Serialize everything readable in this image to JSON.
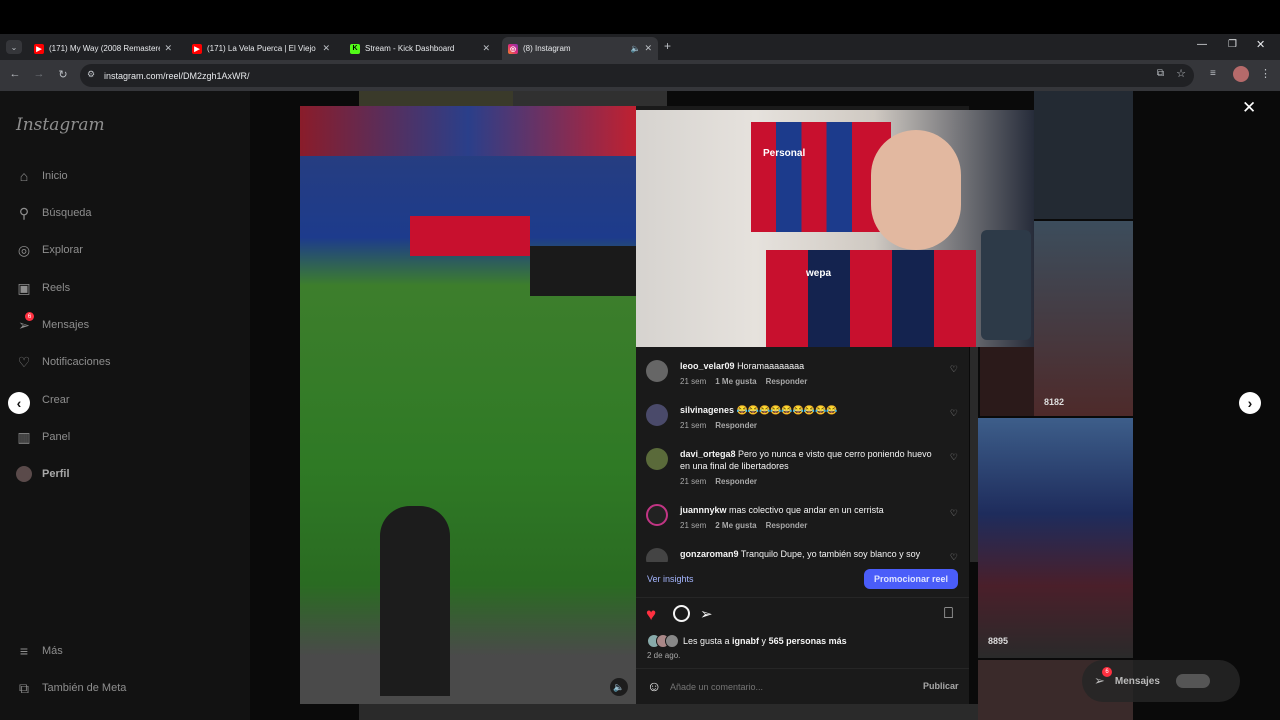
{
  "browser": {
    "tabs": [
      {
        "title": "(171) My Way (2008 Remastered)",
        "favicon": "youtube-icon",
        "active": false
      },
      {
        "title": "(171) La Vela Puerca | El Viejo |",
        "favicon": "youtube-icon",
        "active": false
      },
      {
        "title": "Stream - Kick Dashboard",
        "favicon": "kick-icon",
        "active": false
      },
      {
        "title": "(8) Instagram",
        "favicon": "instagram-icon",
        "active": true
      }
    ],
    "url": "instagram.com/reel/DM2zgh1AxWR/"
  },
  "sidebar": {
    "logo": "Instagram",
    "items": [
      {
        "label": "Inicio",
        "icon": "home-icon"
      },
      {
        "label": "Búsqueda",
        "icon": "search-icon"
      },
      {
        "label": "Explorar",
        "icon": "compass-icon"
      },
      {
        "label": "Reels",
        "icon": "reels-icon"
      },
      {
        "label": "Mensajes",
        "icon": "messages-icon",
        "badge": "6"
      },
      {
        "label": "Notificaciones",
        "icon": "heart-icon"
      },
      {
        "label": "Crear",
        "icon": "plus-icon"
      },
      {
        "label": "Panel",
        "icon": "chart-icon"
      },
      {
        "label": "Perfil",
        "icon": "avatar"
      }
    ],
    "more": "Más",
    "meta": "También de Meta"
  },
  "background": {
    "tile1_caption": "8182",
    "tile2_caption": "8895",
    "messages_label": "Mensajes",
    "messages_badge": "6"
  },
  "camera": {
    "shirt_text": "Personal",
    "jersey_text": "wepa"
  },
  "comments": [
    {
      "user": "leoo_velar09",
      "text": "Horamaaaaaaaa",
      "time": "21 sem",
      "likes": "1 Me gusta",
      "reply": "Responder"
    },
    {
      "user": "silvinagenes",
      "text": "😂😂😂😂😂😂😂😂😂",
      "time": "21 sem",
      "likes": "",
      "reply": "Responder"
    },
    {
      "user": "davi_ortega8",
      "text": "Pero yo nunca e visto que cerro poniendo huevo en una final de libertadores",
      "time": "21 sem",
      "likes": "",
      "reply": "Responder"
    },
    {
      "user": "juannnykw",
      "text": "mas colectivo que andar en un cerrista",
      "time": "21 sem",
      "likes": "2 Me gusta",
      "reply": "Responder"
    },
    {
      "user": "gonzaroman9",
      "text": "Tranquilo Dupe, yo también soy blanco y soy",
      "time": "",
      "likes": "",
      "reply": ""
    }
  ],
  "panel": {
    "insights": "Ver insights",
    "promote": "Promocionar reel",
    "likes_text_prefix": "Les gusta a ",
    "likes_user": "ignabf",
    "likes_text_mid": " y ",
    "likes_count": "565 personas más",
    "date": "2 de ago.",
    "comment_placeholder": "Añade un comentario...",
    "publish": "Publicar"
  },
  "colors": {
    "accent": "#4a5df9",
    "like": "#ff3040",
    "link": "#a5b6ff"
  }
}
